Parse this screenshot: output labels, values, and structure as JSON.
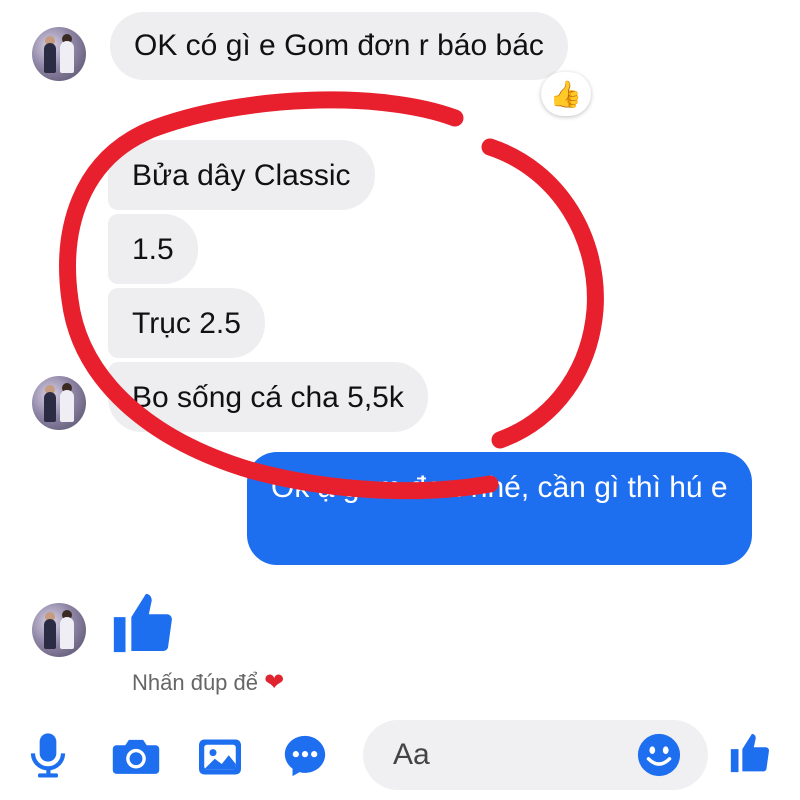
{
  "chat": {
    "messages": [
      {
        "text": "OK có gì e Gom đơn r báo bác",
        "reaction": "👍"
      },
      {
        "text": "Bửa dây Classic"
      },
      {
        "text": "1.5"
      },
      {
        "text": "Trục 2.5"
      },
      {
        "text": "Bo sống cá cha 5,5k"
      },
      {
        "text": "Ok ạ gom đơn nhé, cần gì thì hú e"
      }
    ],
    "double_tap_hint": "Nhấn đúp để",
    "heart": "❤"
  },
  "composer": {
    "placeholder": "Aa"
  },
  "colors": {
    "accent": "#1e6ff0",
    "annotation": "#e8202e",
    "received_bubble": "#eeeef0"
  },
  "icons": [
    "microphone-icon",
    "camera-icon",
    "image-icon",
    "more-icon",
    "emoji-icon",
    "thumbs-up-icon"
  ]
}
